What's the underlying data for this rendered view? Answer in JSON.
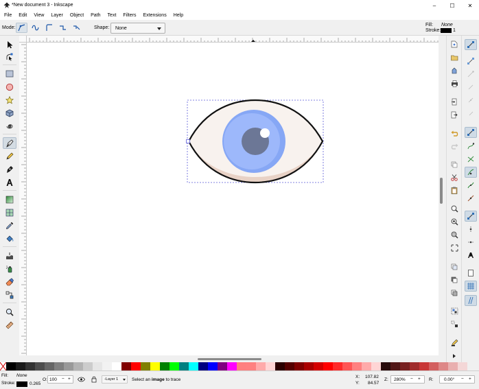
{
  "window": {
    "title": "*New document 3 - Inkscape",
    "controls": [
      "–",
      "☐",
      "✕"
    ]
  },
  "menu": [
    "File",
    "Edit",
    "View",
    "Layer",
    "Object",
    "Path",
    "Text",
    "Filters",
    "Extensions",
    "Help"
  ],
  "tool_controls": {
    "mode_label": "Mode:",
    "shape_label": "Shape:",
    "shape_value": "None",
    "fill_label": "Fill:",
    "fill_value": "None",
    "stroke_label": "Stroke:",
    "stroke_width": "1"
  },
  "toolbox": {
    "tools": [
      "selector-tool",
      "node-tool",
      "rect-tool",
      "ellipse-tool",
      "star-tool",
      "3dbox-tool",
      "spiral-tool",
      "bezier-tool",
      "pencil-tool",
      "calligraphy-tool",
      "text-tool",
      "gradient-tool",
      "mesh-tool",
      "dropper-tool",
      "paint-bucket-tool",
      "tweak-tool",
      "spray-tool",
      "eraser-tool",
      "connector-tool",
      "zoom-tool",
      "measure-tool"
    ],
    "active": "bezier-tool"
  },
  "canvas": {
    "colors": {
      "eye_outline": "#111111",
      "sclera": "#f8f2ee",
      "sclera_shadow": "#e8d2c6",
      "iris_outer": "#86a7f5",
      "iris_inner": "#9db8fb",
      "pupil": "#6c7796",
      "highlight": "#ffffff",
      "selection_box": "#5a5ad8"
    }
  },
  "palette": [
    "#000000",
    "#1a1a1a",
    "#333333",
    "#4d4d4d",
    "#666666",
    "#808080",
    "#999999",
    "#b3b3b3",
    "#cccccc",
    "#e6e6e6",
    "#f2f2f2",
    "#ffffff",
    "#800000",
    "#ff0000",
    "#808000",
    "#ffff00",
    "#008000",
    "#00ff00",
    "#008080",
    "#00ffff",
    "#000080",
    "#0000ff",
    "#800080",
    "#ff00ff",
    "#ff7f7f",
    "#ff8080",
    "#ffaaaa",
    "#ffd5d5",
    "#2b0000",
    "#550000",
    "#800000",
    "#aa0000",
    "#d40000",
    "#ff0000",
    "#ff2a2a",
    "#ff5555",
    "#ff8080",
    "#ffaaaa",
    "#ffd5d5",
    "#280b0b",
    "#501616",
    "#782121",
    "#a02c2c",
    "#c83737",
    "#d35f5f",
    "#de8787",
    "#e9afaf",
    "#f4d7d7"
  ],
  "status": {
    "fill_label": "Fill:",
    "fill_value": "None",
    "stroke_label": "Stroke:",
    "stroke_width": "0.265",
    "opacity_label": "O:",
    "opacity_value": "100",
    "layer": "-Layer 1",
    "message_pre": "Select an ",
    "message_bold": "image",
    "message_post": " to trace",
    "x_label": "X:",
    "x_value": "107.82",
    "y_label": "Y:",
    "y_value": "84.57",
    "zoom_label": "Z:",
    "zoom_value": "280%",
    "rotate_label": "R:",
    "rotate_value": "0.00°"
  }
}
